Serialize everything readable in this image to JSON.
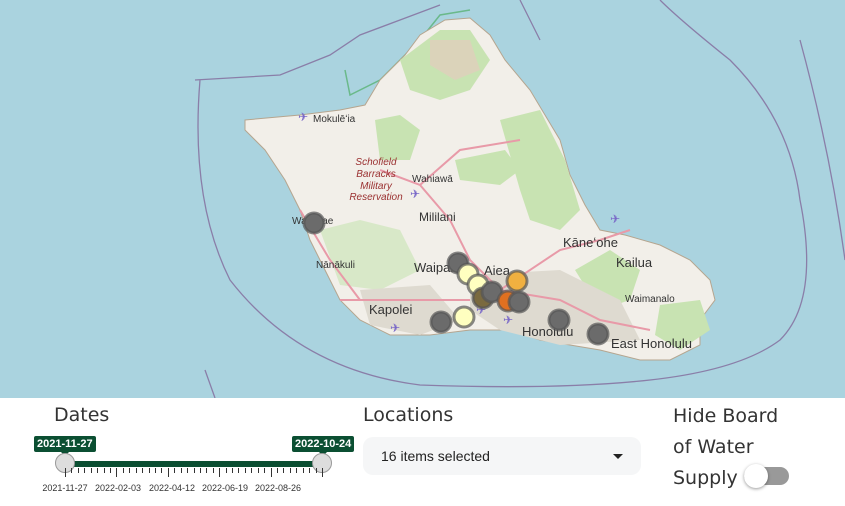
{
  "map": {
    "place_labels": [
      {
        "key": "mokuleia",
        "text": "Mokulēʻia"
      },
      {
        "key": "schofield",
        "text": "Schofield Barracks Military Reservation"
      },
      {
        "key": "wahiawa",
        "text": "Wahiawā"
      },
      {
        "key": "mililani",
        "text": "Mililani"
      },
      {
        "key": "waianae",
        "text": "Waiʻanae"
      },
      {
        "key": "nanakuli",
        "text": "Nānākuli"
      },
      {
        "key": "waipahu",
        "text": "Waipahu"
      },
      {
        "key": "aiea",
        "text": "Aiea"
      },
      {
        "key": "kapolei",
        "text": "Kapolei"
      },
      {
        "key": "honolulu",
        "text": "Honolulu"
      },
      {
        "key": "kaneohe",
        "text": "Kāneʻohe"
      },
      {
        "key": "kailua",
        "text": "Kailua"
      },
      {
        "key": "waimanalo",
        "text": "Waimanalo"
      },
      {
        "key": "east_honolulu",
        "text": "East Honolulu"
      }
    ],
    "colors": {
      "ocean": "#aad3df",
      "land": "#f2efe9",
      "green": "#c8e3b2",
      "marker_gray": "#6b6b6b",
      "marker_pale": "#ffffc0",
      "marker_orange": "#f0a030"
    }
  },
  "dates": {
    "label": "Dates",
    "start": "2021-11-27",
    "end": "2022-10-24",
    "ticks": [
      "2021-11-27",
      "2022-02-03",
      "2022-04-12",
      "2022-06-19",
      "2022-08-26"
    ]
  },
  "locations": {
    "label": "Locations",
    "selected_text": "16 items selected"
  },
  "toggle": {
    "label": "Hide Board of Water Supply",
    "on": false
  }
}
